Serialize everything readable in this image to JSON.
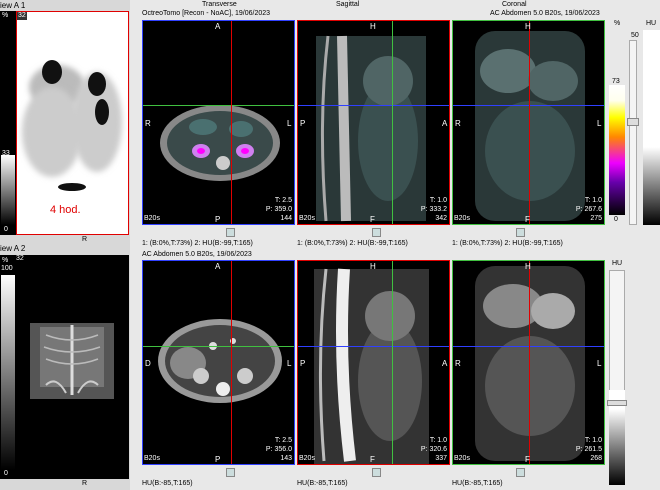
{
  "left_panel": {
    "view1_header": "iew A 1",
    "view1_pct": "%",
    "view1_badge": "32",
    "view1_scale_mid": "33",
    "view1_scale_min": "0",
    "view1_caption": "4 hod.",
    "view1_footer": "R",
    "view2_header": "iew A 2",
    "view2_pct": "%",
    "view2_scale_max": "100",
    "view2_badge": "32",
    "view2_scale_min": "0",
    "view2_footer": "R"
  },
  "top_row": {
    "info_left": "OctreoTomo [Recon - NoAC], 19/06/2023",
    "info_right": "AC Abdomen  5.0  B20s, 19/06/2023",
    "titles": [
      "Transverse",
      "Sagittal",
      "Coronal"
    ],
    "pct_label": "%",
    "scale_top": "50",
    "scale_marker": "73",
    "scale_bottom": "0",
    "hu_label": "HU",
    "transverse": {
      "top": "A",
      "left": "R",
      "right": "L",
      "bottom": "P",
      "t": "T: 2.5",
      "p": "P: 359.0",
      "slice": "144",
      "series": "B20s"
    },
    "sagittal": {
      "top": "H",
      "left": "P",
      "right": "A",
      "bottom": "F",
      "t": "T: 1.0",
      "p": "P: 333.2",
      "slice": "342",
      "series": "B20s"
    },
    "coronal": {
      "top": "H",
      "left": "R",
      "right": "L",
      "bottom": "F",
      "t": "T: 1.0",
      "p": "P: 267.6",
      "slice": "275",
      "series": "B20s"
    },
    "window_labels": [
      "1: (B:0%,T:73%)   2: HU(B:-99,T:165)",
      "1: (B:0%,T:73%)   2: HU(B:-99,T:165)",
      "1: (B:0%,T:73%)   2: HU(B:-99,T:165)"
    ]
  },
  "bottom_row": {
    "info_left": "AC Abdomen  5.0  B20s, 19/06/2023",
    "hu_label": "HU",
    "transverse": {
      "top": "A",
      "left": "D",
      "right": "L",
      "bottom": "P",
      "t": "T: 2.5",
      "p": "P: 356.0",
      "slice": "143",
      "series": "B20s"
    },
    "sagittal": {
      "top": "H",
      "left": "P",
      "right": "A",
      "bottom": "F",
      "t": "T: 1.0",
      "p": "P: 320.6",
      "slice": "337",
      "series": "B20s"
    },
    "coronal": {
      "top": "H",
      "left": "R",
      "right": "L",
      "bottom": "F",
      "t": "T: 1.0",
      "p": "P: 261.5",
      "slice": "268",
      "series": "B20s"
    },
    "window_labels": [
      "HU(B:-85,T:165)",
      "HU(B:-85,T:165)",
      "HU(B:-85,T:165)"
    ]
  },
  "colors": {
    "accent_red": "#e00000",
    "crosshair_blue": "#3040ff",
    "crosshair_green": "#40c040",
    "frame_purple": "#6040a0"
  }
}
